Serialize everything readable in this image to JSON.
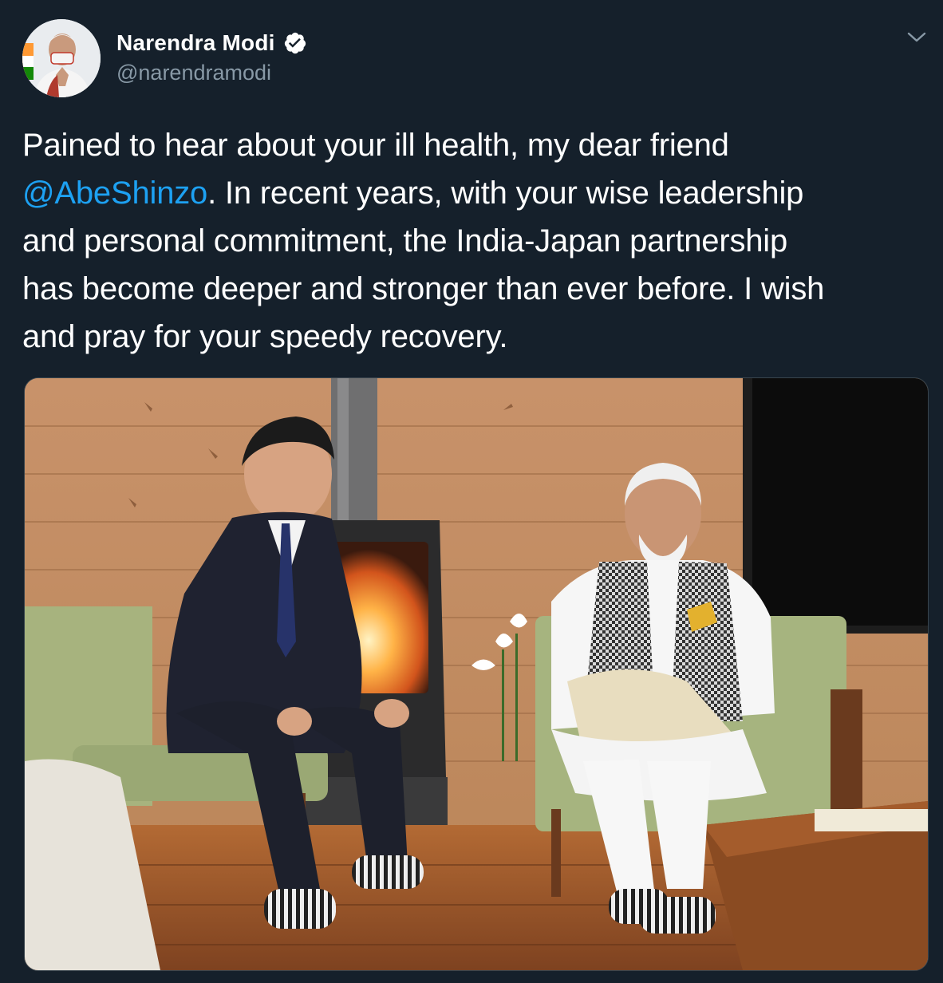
{
  "author": {
    "display_name": "Narendra Modi",
    "handle": "@narendramodi",
    "verified": true,
    "avatar_icon": "profile-avatar"
  },
  "tweet": {
    "lines": [
      {
        "pre": "Pained to hear about your ill health, my dear friend",
        "mention": "",
        "post": ""
      },
      {
        "pre": "",
        "mention": "@AbeShinzo",
        "post": ". In recent years, with your wise leadership"
      },
      {
        "pre": "and personal commitment, the India-Japan partnership",
        "mention": "",
        "post": ""
      },
      {
        "pre": "has become deeper and stronger than ever before. I wish",
        "mention": "",
        "post": ""
      },
      {
        "pre": "and pray for your speedy recovery.",
        "mention": "",
        "post": ""
      }
    ]
  },
  "media": {
    "type": "photo",
    "icon": "photo-of-two-men-seated-by-fireplace"
  },
  "colors": {
    "background": "#15202b",
    "text": "#ffffff",
    "secondary_text": "#8899a6",
    "link": "#1da1f2",
    "verified_badge": "#ffffff"
  },
  "icons": {
    "verified": "verified-badge-icon",
    "menu": "chevron-down-icon"
  }
}
